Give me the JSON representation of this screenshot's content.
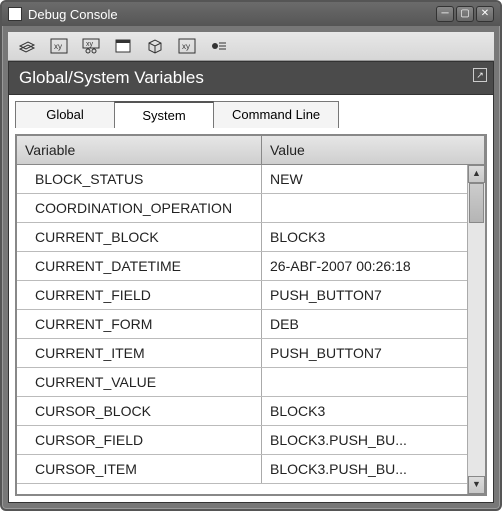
{
  "window": {
    "title": "Debug Console"
  },
  "toolbar_icons": {
    "stack": "stack-icon",
    "vars1": "xy-icon",
    "vars2": "xy2-icon",
    "window": "window-icon",
    "box": "box-icon",
    "xybox": "xybox-icon",
    "break": "breakpoint-icon"
  },
  "panel": {
    "title": "Global/System Variables"
  },
  "tabs": [
    {
      "label": "Global",
      "active": false
    },
    {
      "label": "System",
      "active": true
    },
    {
      "label": "Command Line",
      "active": false
    }
  ],
  "columns": {
    "variable": "Variable",
    "value": "Value"
  },
  "rows": [
    {
      "variable": "BLOCK_STATUS",
      "value": "NEW"
    },
    {
      "variable": "COORDINATION_OPERATION",
      "value": ""
    },
    {
      "variable": "CURRENT_BLOCK",
      "value": "BLOCK3"
    },
    {
      "variable": "CURRENT_DATETIME",
      "value": "26-АВГ-2007 00:26:18"
    },
    {
      "variable": "CURRENT_FIELD",
      "value": "PUSH_BUTTON7"
    },
    {
      "variable": "CURRENT_FORM",
      "value": "DEB"
    },
    {
      "variable": "CURRENT_ITEM",
      "value": "PUSH_BUTTON7"
    },
    {
      "variable": "CURRENT_VALUE",
      "value": ""
    },
    {
      "variable": "CURSOR_BLOCK",
      "value": "BLOCK3"
    },
    {
      "variable": "CURSOR_FIELD",
      "value": "BLOCK3.PUSH_BU..."
    },
    {
      "variable": "CURSOR_ITEM",
      "value": "BLOCK3.PUSH_BU..."
    }
  ]
}
